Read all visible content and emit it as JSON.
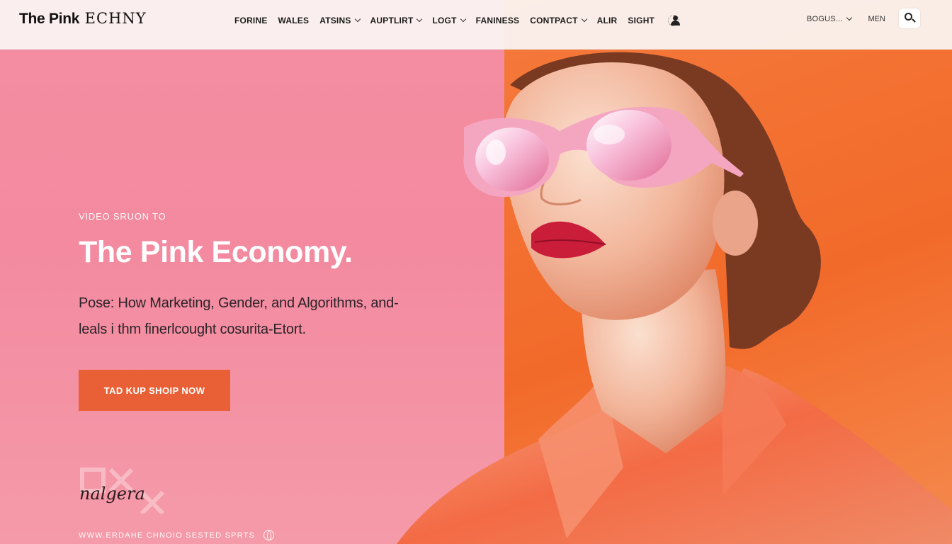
{
  "brand": {
    "name_bold": "The Pink",
    "name_light": "ECHNY"
  },
  "nav": {
    "items": [
      {
        "label": "FORINE",
        "dropdown": false
      },
      {
        "label": "WALES",
        "dropdown": false
      },
      {
        "label": "ATSINS",
        "dropdown": true
      },
      {
        "label": "AUPTLIRT",
        "dropdown": true
      },
      {
        "label": "LOGT",
        "dropdown": true
      },
      {
        "label": "FANINESS",
        "dropdown": false
      },
      {
        "label": "CONTPACT",
        "dropdown": true
      },
      {
        "label": "ALIR",
        "dropdown": false
      },
      {
        "label": "SIGHT",
        "dropdown": false
      }
    ],
    "language": "BOGUS...",
    "menu": "MEN"
  },
  "hero": {
    "eyebrow": "VIDEO SRUON TO",
    "headline": "The Pink Economy.",
    "subtitle": "Pose: How Marketing, Gender, and Algorithms, and-leals i thm finerlcought cosurita-Etort.",
    "cta_label": "TAD KUP SHOIP NOW",
    "signature": "nalgera"
  },
  "footer": {
    "strip_text": "WWW.ERDAHE CHNOIO SESTED SPRTS"
  },
  "colors": {
    "pink_bg": "#f48aa0",
    "orange_bg": "#f26a2a",
    "cta": "#ea6036",
    "nav_bg": "#faf6f4"
  },
  "icons": [
    "user-icon",
    "chevron-down-icon",
    "search-icon",
    "globe-icon"
  ]
}
